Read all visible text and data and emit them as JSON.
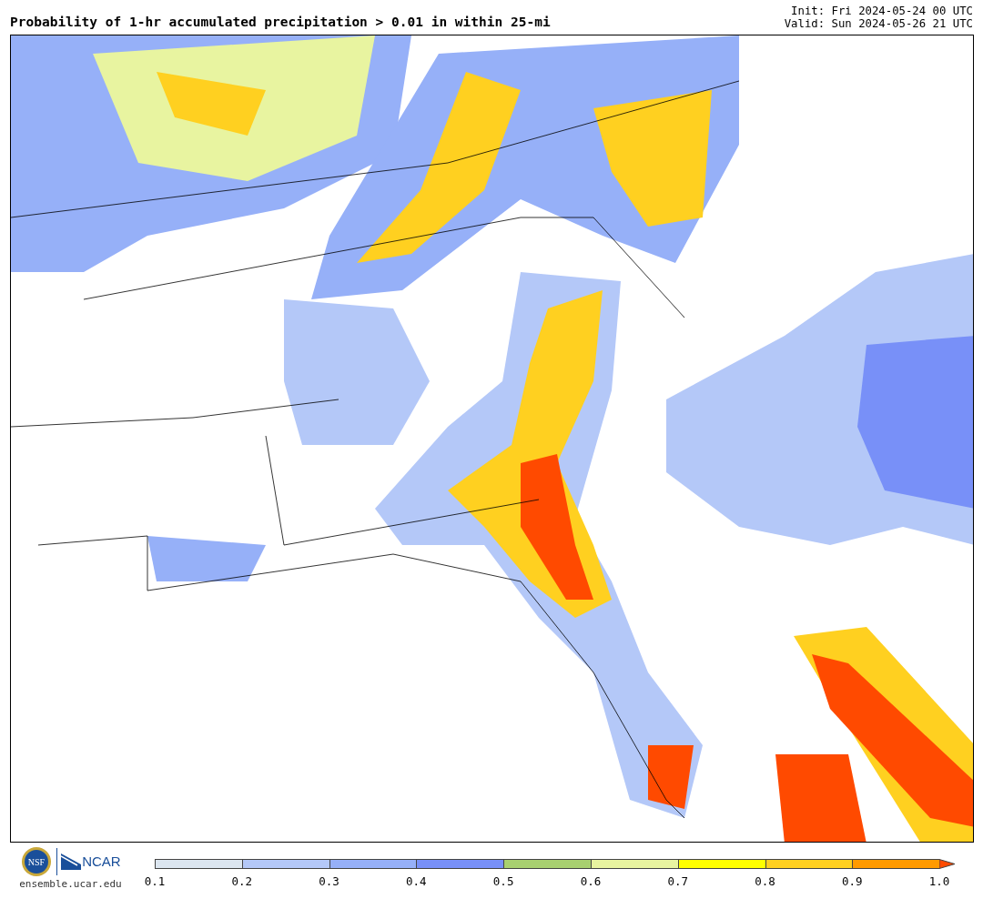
{
  "title": "Probability of 1-hr accumulated precipitation > 0.01 in within 25-mi",
  "init": "Init: Fri 2024-05-24 00 UTC",
  "valid": "Valid: Sun 2024-05-26 21 UTC",
  "logos": {
    "nsf": "NSF",
    "ncar": "NCAR",
    "url": "ensemble.ucar.edu"
  },
  "colorbar": {
    "bins": [
      {
        "color": "#dce6f0"
      },
      {
        "color": "#b4c8f8"
      },
      {
        "color": "#96b0f8"
      },
      {
        "color": "#7890f8"
      },
      {
        "color": "#a8d070"
      },
      {
        "color": "#e8f4a0"
      },
      {
        "color": "#ffff00"
      },
      {
        "color": "#ffd020"
      },
      {
        "color": "#ff9a00"
      }
    ],
    "extension": {
      "color": "#ff4a00"
    },
    "ticks": [
      "0.1",
      "0.2",
      "0.3",
      "0.4",
      "0.5",
      "0.6",
      "0.7",
      "0.8",
      "0.9",
      "1.0"
    ]
  }
}
